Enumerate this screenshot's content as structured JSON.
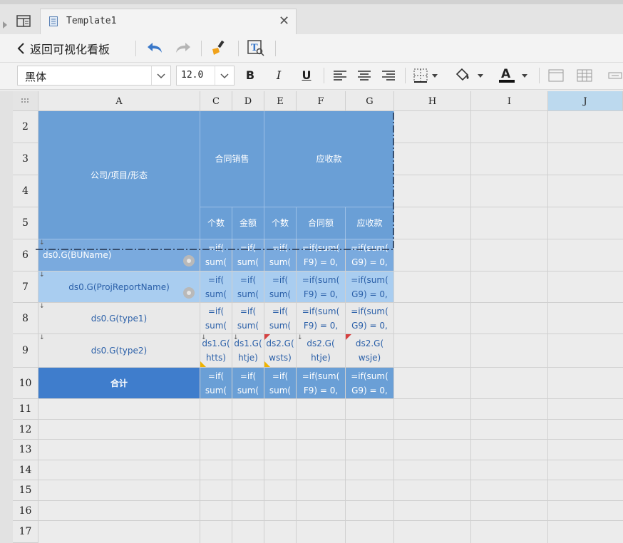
{
  "tab": {
    "title": "Template1"
  },
  "toolbar1": {
    "back_label": "返回可视化看板"
  },
  "toolbar2": {
    "font_name": "黑体",
    "font_size": "12.0",
    "bold_label": "B",
    "italic_label": "I",
    "underline_label": "U"
  },
  "grid": {
    "columns": [
      "A",
      "C",
      "D",
      "E",
      "F",
      "G",
      "H",
      "I",
      "J"
    ],
    "rows": [
      "2",
      "3",
      "4",
      "5",
      "6",
      "7",
      "8",
      "9",
      "10",
      "11",
      "12",
      "13",
      "14",
      "15",
      "16",
      "17"
    ],
    "header": {
      "company": "公司/项目/形态",
      "contract": "合同销售",
      "receivable": "应收款",
      "count1": "个数",
      "amount": "金额",
      "count2": "个数",
      "contract_amount": "合同额",
      "receivable_amount": "应收款"
    },
    "row6": {
      "a": "ds0.G(BUName)",
      "c": "=if( sum(",
      "d": "=if( sum(",
      "e": "=if( sum(",
      "f": "=if(sum( F9) = 0,",
      "g": "=if(sum( G9) = 0,"
    },
    "row7": {
      "a": "ds0.G(ProjReportName)",
      "c": "=if( sum(",
      "d": "=if( sum(",
      "e": "=if( sum(",
      "f": "=if(sum( F9) = 0,",
      "g": "=if(sum( G9) = 0,"
    },
    "row8": {
      "a": "ds0.G(type1)",
      "c": "=if( sum(",
      "d": "=if( sum(",
      "e": "=if( sum(",
      "f": "=if(sum( F9) = 0,",
      "g": "=if(sum( G9) = 0,"
    },
    "row9": {
      "a": "ds0.G(type2)",
      "c": "ds1.G( htts)",
      "d": "ds1.G( htje)",
      "e": "ds2.G( wsts)",
      "f": "ds2.G( htje)",
      "g": "ds2.G( wsje)"
    },
    "row10": {
      "a": "合计",
      "c": "=if( sum(",
      "d": "=if( sum(",
      "e": "=if( sum(",
      "f": "=if(sum( F9) = 0,",
      "g": "=if(sum( G9) = 0,"
    }
  },
  "colors": {
    "header_blue": "#6a9fd6",
    "total_blue": "#3f7dcc",
    "selected_col": "#bcd9ee"
  }
}
